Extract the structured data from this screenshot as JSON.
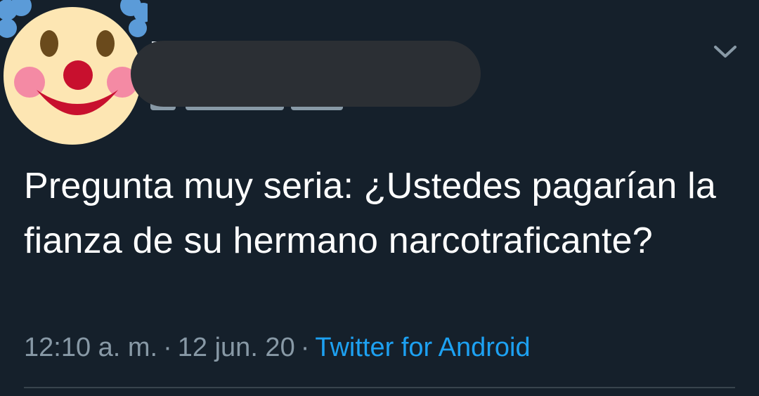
{
  "tweet": {
    "author": {
      "avatar_icon": "clown-face-icon"
    },
    "text": "Pregunta muy seria: ¿Ustedes pagarían la fianza de su hermano narcotraficante?",
    "time": "12:10 a. m.",
    "separator": "·",
    "date": "12 jun. 20",
    "source": "Twitter for Android",
    "menu_icon": "chevron-down-icon"
  },
  "colors": {
    "background": "#15202b",
    "text": "#ffffff",
    "secondary": "#8899a6",
    "link": "#1da1f2",
    "redaction": "#2b2f34",
    "divider": "#38444d"
  }
}
